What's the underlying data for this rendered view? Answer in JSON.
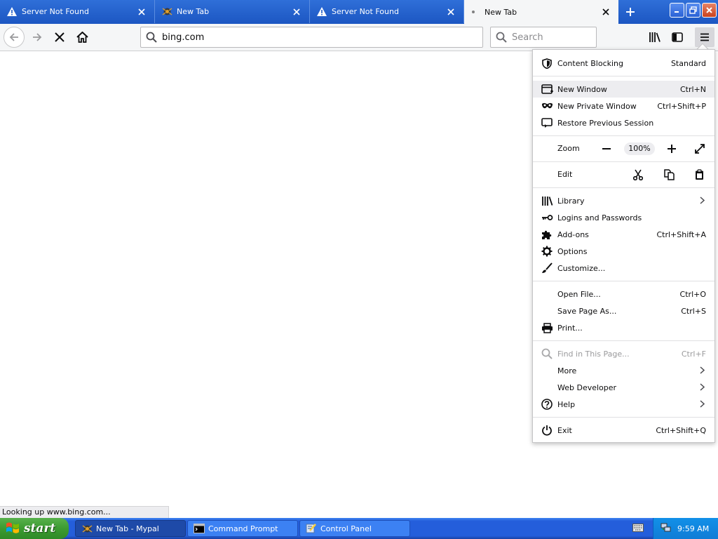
{
  "tabs": [
    {
      "title": "Server Not Found",
      "icon": "warning-icon"
    },
    {
      "title": "New Tab",
      "icon": "mypal-icon"
    },
    {
      "title": "Server Not Found",
      "icon": "warning-icon"
    },
    {
      "title": "New Tab",
      "icon": "loading-dot",
      "active": true
    }
  ],
  "navbar": {
    "url": "bing.com",
    "search_placeholder": "Search"
  },
  "menu": {
    "content_blocking": {
      "label": "Content Blocking",
      "value": "Standard"
    },
    "new_window": {
      "label": "New Window",
      "shortcut": "Ctrl+N"
    },
    "new_private_window": {
      "label": "New Private Window",
      "shortcut": "Ctrl+Shift+P"
    },
    "restore_session": {
      "label": "Restore Previous Session"
    },
    "zoom": {
      "label": "Zoom",
      "value": "100%"
    },
    "edit": {
      "label": "Edit"
    },
    "library": {
      "label": "Library"
    },
    "logins": {
      "label": "Logins and Passwords"
    },
    "addons": {
      "label": "Add-ons",
      "shortcut": "Ctrl+Shift+A"
    },
    "options": {
      "label": "Options"
    },
    "customize": {
      "label": "Customize..."
    },
    "open_file": {
      "label": "Open File...",
      "shortcut": "Ctrl+O"
    },
    "save_page": {
      "label": "Save Page As...",
      "shortcut": "Ctrl+S"
    },
    "print": {
      "label": "Print..."
    },
    "find": {
      "label": "Find in This Page...",
      "shortcut": "Ctrl+F"
    },
    "more": {
      "label": "More"
    },
    "web_developer": {
      "label": "Web Developer"
    },
    "help": {
      "label": "Help"
    },
    "exit": {
      "label": "Exit",
      "shortcut": "Ctrl+Shift+Q"
    }
  },
  "status": {
    "text": "Looking up www.bing.com..."
  },
  "taskbar": {
    "start_label": "start",
    "tasks": [
      {
        "label": "New Tab - Mypal",
        "active": true
      },
      {
        "label": "Command Prompt"
      },
      {
        "label": "Control Panel"
      }
    ],
    "clock": "9:59 AM"
  },
  "colors": {
    "tabstrip": "#1c56c2",
    "taskbar": "#245edb",
    "start_green": "#3c9b31",
    "close_red": "#c9421e",
    "menu_highlight": "#ededf0"
  }
}
